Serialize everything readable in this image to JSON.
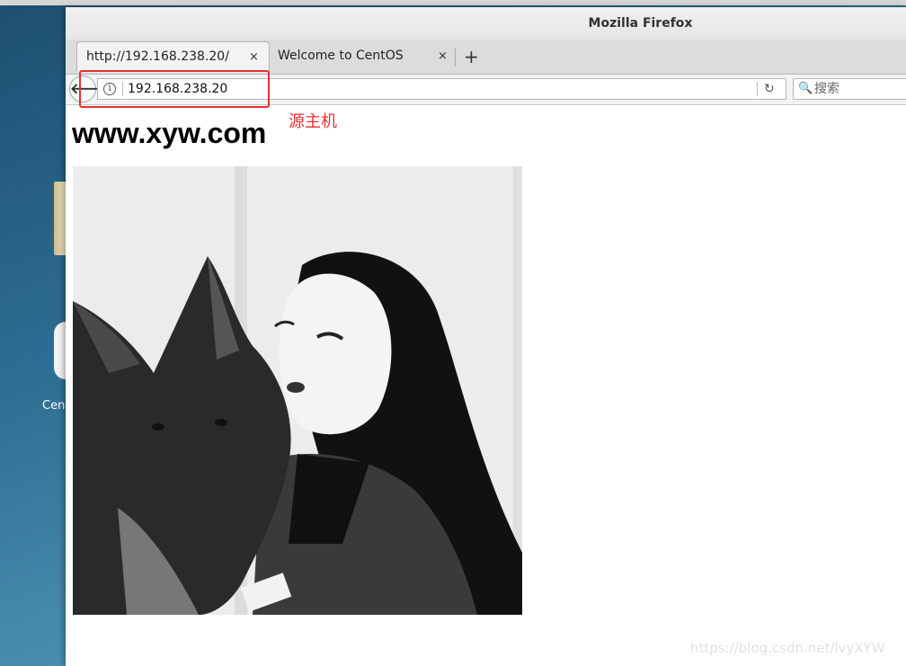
{
  "desktop": {
    "icon_label": "CentOS"
  },
  "window": {
    "title": "Mozilla Firefox"
  },
  "tabs": [
    {
      "label": "http://192.168.238.20/",
      "close": "×",
      "active": true
    },
    {
      "label": "Welcome to CentOS",
      "close": "×",
      "active": false
    }
  ],
  "new_tab_label": "+",
  "navbar": {
    "back_glyph": "🡐",
    "info_glyph": "i",
    "url": "192.168.238.20",
    "reload_glyph": "↻",
    "search_placeholder": "搜索",
    "search_glyph": "🔍"
  },
  "page": {
    "heading": "www.xyw.com"
  },
  "annotation": {
    "label": "源主机",
    "color": "#e53030"
  },
  "watermark": "https://blog.csdn.net/lvyXYW"
}
